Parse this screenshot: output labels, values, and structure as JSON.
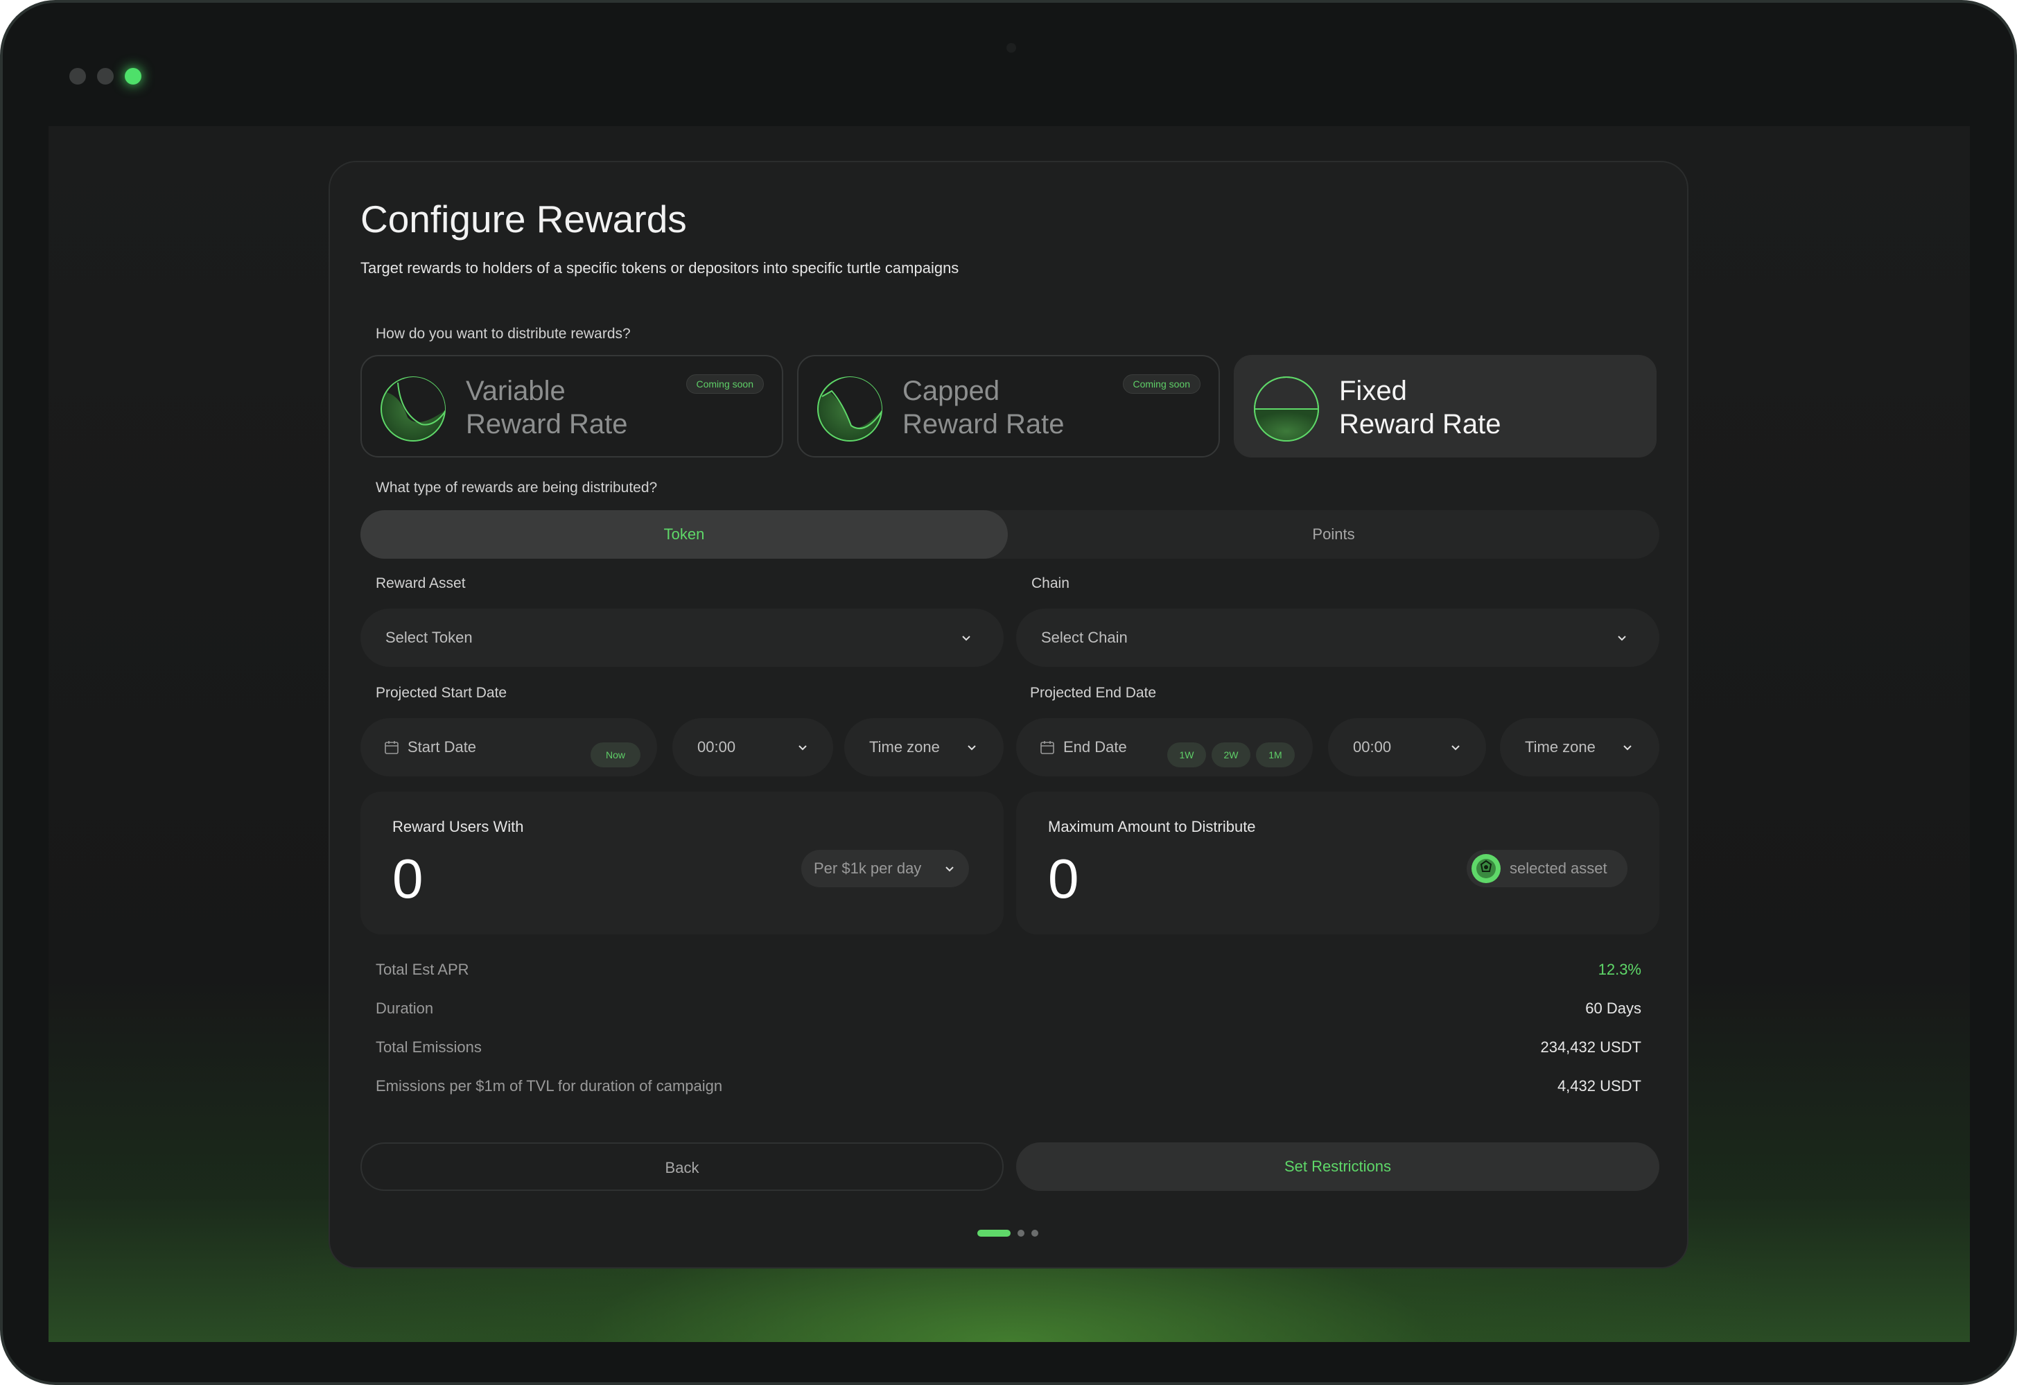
{
  "page": {
    "title": "Configure Rewards",
    "subtitle": "Target rewards to holders of a specific tokens or depositors into specific turtle campaigns"
  },
  "distribution": {
    "question": "How do you want to distribute rewards?",
    "options": [
      {
        "title_line1": "Variable",
        "title_line2": "Reward Rate",
        "badge": "Coming soon",
        "selected": false
      },
      {
        "title_line1": "Capped",
        "title_line2": "Reward Rate",
        "badge": "Coming soon",
        "selected": false
      },
      {
        "title_line1": "Fixed",
        "title_line2": "Reward Rate",
        "badge": "",
        "selected": true
      }
    ]
  },
  "reward_type": {
    "question": "What type of rewards are being distributed?",
    "tabs": [
      {
        "label": "Token",
        "active": true
      },
      {
        "label": "Points",
        "active": false
      }
    ]
  },
  "fields": {
    "reward_asset_label": "Reward Asset",
    "reward_asset_placeholder": "Select Token",
    "chain_label": "Chain",
    "chain_placeholder": "Select Chain",
    "start_label": "Projected Start Date",
    "start_date_placeholder": "Start Date",
    "start_now": "Now",
    "start_time": "00:00",
    "start_timezone": "Time zone",
    "end_label": "Projected End Date",
    "end_date_placeholder": "End Date",
    "end_presets": [
      "1W",
      "2W",
      "1M"
    ],
    "end_time": "00:00",
    "end_timezone": "Time zone"
  },
  "amounts": {
    "reward_label": "Reward Users With",
    "reward_value": "0",
    "reward_unit": "Per $1k per day",
    "max_label": "Maximum Amount to Distribute",
    "max_value": "0",
    "max_asset": "selected asset"
  },
  "summary": {
    "apr_label": "Total Est APR",
    "apr_value": "12.3%",
    "duration_label": "Duration",
    "duration_value": "60 Days",
    "emissions_label": "Total Emissions",
    "emissions_value": "234,432 USDT",
    "per_tvl_label": "Emissions per $1m of TVL for duration of campaign",
    "per_tvl_value": "4,432 USDT"
  },
  "actions": {
    "back": "Back",
    "next": "Set Restrictions"
  },
  "pagination": {
    "total": 3,
    "current": 1
  },
  "colors": {
    "accent": "#5fd869",
    "background": "#1e1f1f",
    "surface": "#252626"
  }
}
